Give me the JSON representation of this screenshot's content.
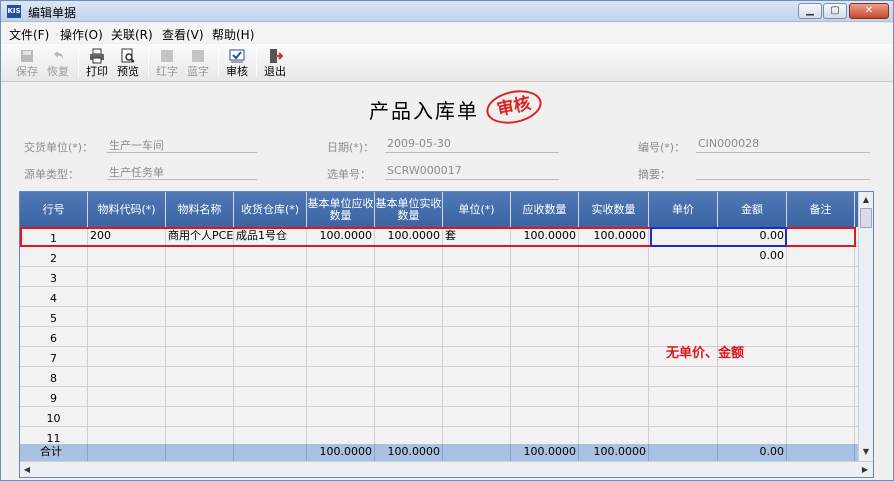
{
  "window": {
    "title": "编辑单据",
    "logo": "KIS"
  },
  "menu": [
    "文件(F)",
    "操作(O)",
    "关联(R)",
    "查看(V)",
    "帮助(H)"
  ],
  "toolbar": [
    {
      "label": "保存",
      "icon": "save-icon",
      "enabled": false
    },
    {
      "label": "恢复",
      "icon": "undo-icon",
      "enabled": false
    },
    {
      "label": "打印",
      "icon": "print-icon",
      "enabled": true
    },
    {
      "label": "预览",
      "icon": "preview-icon",
      "enabled": true
    },
    {
      "label": "红字",
      "icon": "red-doc-icon",
      "enabled": false
    },
    {
      "label": "蓝字",
      "icon": "blue-doc-icon",
      "enabled": false
    },
    {
      "label": "审核",
      "icon": "audit-icon",
      "enabled": true
    },
    {
      "label": "退出",
      "icon": "exit-icon",
      "enabled": true
    }
  ],
  "document": {
    "title": "产品入库单",
    "stamp": "审核"
  },
  "fields": {
    "supplier_label": "交货单位(*)：",
    "supplier_value": "生产一车间",
    "date_label": "日期(*)：",
    "date_value": "2009-05-30",
    "number_label": "编号(*)：",
    "number_value": "CIN000028",
    "source_type_label": "源单类型：",
    "source_type_value": "生产任务单",
    "select_no_label": "选单号：",
    "select_no_value": "SCRW000017",
    "summary_label": "摘要：",
    "summary_value": ""
  },
  "grid": {
    "columns": [
      "行号",
      "物料代码(*)",
      "物料名称",
      "收货仓库(*)",
      "基本单位应收数量",
      "基本单位实收数量",
      "单位(*)",
      "应收数量",
      "实收数量",
      "单价",
      "金额",
      "备注"
    ],
    "rows": [
      [
        "1",
        "200",
        "商用个人PCE",
        "成品1号仓",
        "100.0000",
        "100.0000",
        "套",
        "100.0000",
        "100.0000",
        "",
        "0.00",
        ""
      ],
      [
        "2",
        "",
        "",
        "",
        "",
        "",
        "",
        "",
        "",
        "",
        "0.00",
        ""
      ],
      [
        "3",
        "",
        "",
        "",
        "",
        "",
        "",
        "",
        "",
        "",
        "",
        ""
      ],
      [
        "4",
        "",
        "",
        "",
        "",
        "",
        "",
        "",
        "",
        "",
        "",
        ""
      ],
      [
        "5",
        "",
        "",
        "",
        "",
        "",
        "",
        "",
        "",
        "",
        "",
        ""
      ],
      [
        "6",
        "",
        "",
        "",
        "",
        "",
        "",
        "",
        "",
        "",
        "",
        ""
      ],
      [
        "7",
        "",
        "",
        "",
        "",
        "",
        "",
        "",
        "",
        "",
        "",
        ""
      ],
      [
        "8",
        "",
        "",
        "",
        "",
        "",
        "",
        "",
        "",
        "",
        "",
        ""
      ],
      [
        "9",
        "",
        "",
        "",
        "",
        "",
        "",
        "",
        "",
        "",
        "",
        ""
      ],
      [
        "10",
        "",
        "",
        "",
        "",
        "",
        "",
        "",
        "",
        "",
        "",
        ""
      ],
      [
        "11",
        "",
        "",
        "",
        "",
        "",
        "",
        "",
        "",
        "",
        "",
        ""
      ]
    ],
    "total": [
      "合计",
      "",
      "",
      "",
      "100.0000",
      "100.0000",
      "",
      "100.0000",
      "100.0000",
      "",
      "0.00",
      ""
    ]
  },
  "annotation": "无单价、金额",
  "colors": {
    "header": "#4f78b5",
    "highlight": "#e0161e",
    "focus": "#1d2bd6",
    "total": "#a9c2e2"
  }
}
